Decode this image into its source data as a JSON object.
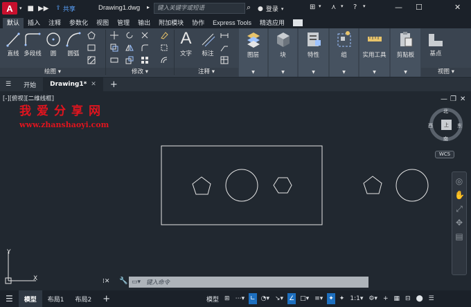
{
  "titlebar": {
    "logo": "A",
    "share_label": "共享",
    "doc_title": "Drawing1.dwg",
    "search_placeholder": "键入关键字或短语",
    "login_label": "登录"
  },
  "ribbon_tabs": [
    "默认",
    "插入",
    "注释",
    "参数化",
    "视图",
    "管理",
    "输出",
    "附加模块",
    "协作",
    "Express Tools",
    "精选应用"
  ],
  "ribbon": {
    "draw": {
      "line": "直线",
      "polyline": "多段线",
      "circle": "圆",
      "arc": "圆弧",
      "panel": "绘图"
    },
    "modify": {
      "panel": "修改"
    },
    "annotation": {
      "text": "文字",
      "dim": "标注",
      "panel": "注释"
    },
    "layers": "图层",
    "block": "块",
    "properties": "特性",
    "group": "组",
    "utilities": "实用工具",
    "clipboard": "剪贴板",
    "base": "基点",
    "view_panel": "视图"
  },
  "filetabs": {
    "start": "开始",
    "drawing": "Drawing1*"
  },
  "canvas": {
    "viewport_label": "[-][俯视][二维线框]",
    "watermark_title": "我爱分享网",
    "watermark_url": "www.zhanshaoyi.com",
    "viewcube": {
      "north": "北",
      "south": "南",
      "east": "东",
      "west": "西",
      "face": "上",
      "wcs": "WCS"
    },
    "ucs": {
      "x": "X",
      "y": "Y"
    }
  },
  "command": {
    "placeholder": "键入命令"
  },
  "statusbar": {
    "model_tab": "模型",
    "layout1": "布局1",
    "layout2": "布局2",
    "model_label": "模型",
    "scale": "1:1"
  },
  "colors": {
    "accent": "#1d6fbf",
    "watermark": "#e0141e",
    "logo": "#c8102e"
  }
}
